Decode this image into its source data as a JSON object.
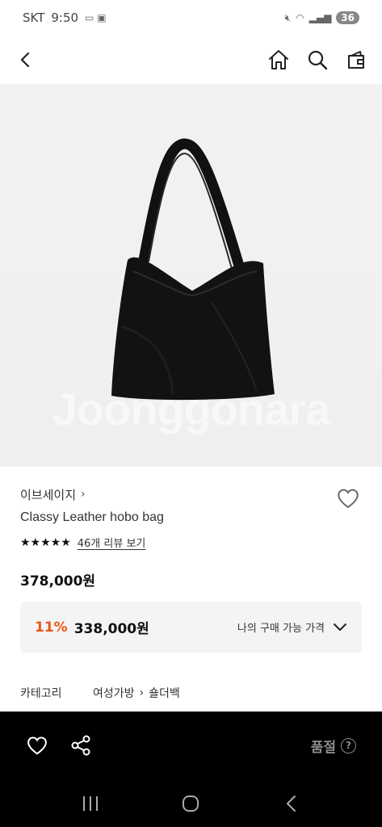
{
  "status_bar": {
    "carrier": "SKT",
    "time": "9:50",
    "battery": "36"
  },
  "product": {
    "brand": "이브세이지",
    "name": "Classy Leather hobo bag",
    "rating_stars": "★★★★★",
    "rating": 5,
    "review_link": "46개 리뷰 보기",
    "price": "378,000원",
    "watermark": "Joonggonara"
  },
  "discount": {
    "rate": "11%",
    "price": "338,000원",
    "options_label": "나의 구매 가능 가격"
  },
  "category": {
    "label": "카테고리",
    "path": [
      "여성가방",
      "숄더백"
    ]
  },
  "bottom_bar": {
    "status_label": "품절",
    "help_icon": "?"
  },
  "colors": {
    "accent": "#e8571a",
    "bottom_bg": "#000000",
    "discount_bg": "#f4f4f4"
  }
}
